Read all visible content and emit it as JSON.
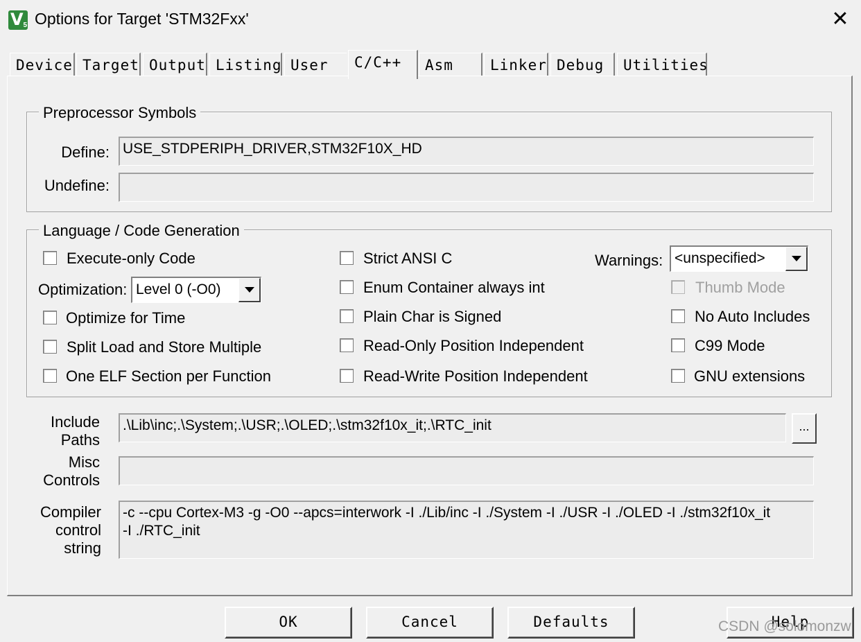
{
  "window": {
    "title": "Options for Target 'STM32Fxx'"
  },
  "tabs": [
    "Device",
    "Target",
    "Output",
    "Listing",
    "User",
    "C/C++",
    "Asm",
    "Linker",
    "Debug",
    "Utilities"
  ],
  "active_tab": "C/C++",
  "preprocessor": {
    "legend": "Preprocessor Symbols",
    "define_label": "Define:",
    "define_value": "USE_STDPERIPH_DRIVER,STM32F10X_HD",
    "undefine_label": "Undefine:",
    "undefine_value": ""
  },
  "language": {
    "legend": "Language / Code Generation",
    "execute_only": "Execute-only Code",
    "optimization_label": "Optimization:",
    "optimization_value": "Level 0 (-O0)",
    "optimize_time": "Optimize for Time",
    "split_load": "Split Load and Store Multiple",
    "one_elf": "One ELF Section per Function",
    "strict_ansi": "Strict ANSI C",
    "enum_container": "Enum Container always int",
    "plain_char": "Plain Char is Signed",
    "ro_pos": "Read-Only Position Independent",
    "rw_pos": "Read-Write Position Independent",
    "warnings_label": "Warnings:",
    "warnings_value": "<unspecified>",
    "thumb_mode": "Thumb Mode",
    "no_auto": "No Auto Includes",
    "c99": "C99 Mode",
    "gnu": "GNU extensions"
  },
  "include": {
    "label_1": "Include",
    "label_2": "Paths",
    "value": ".\\Lib\\inc;.\\System;.\\USR;.\\OLED;.\\stm32f10x_it;.\\RTC_init",
    "browse": "..."
  },
  "misc": {
    "label_1": "Misc",
    "label_2": "Controls",
    "value": ""
  },
  "compiler": {
    "label_1": "Compiler",
    "label_2": "control",
    "label_3": "string",
    "value": "-c --cpu Cortex-M3 -g -O0 --apcs=interwork -I ./Lib/inc -I ./System -I ./USR -I ./OLED -I ./stm32f10x_it\n-I ./RTC_init"
  },
  "buttons": {
    "ok": "OK",
    "cancel": "Cancel",
    "defaults": "Defaults",
    "help": "Help"
  },
  "watermark": "CSDN @solomonzw"
}
